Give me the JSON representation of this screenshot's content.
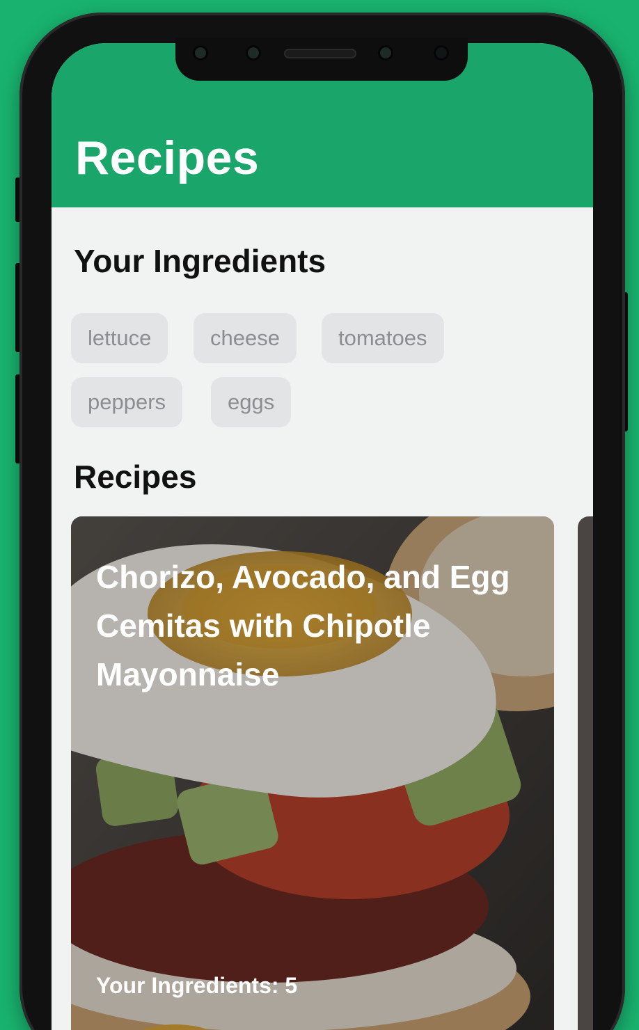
{
  "appbar": {
    "title": "Recipes"
  },
  "ingredients": {
    "heading": "Your Ingredients",
    "chips": [
      "lettuce",
      "cheese",
      "tomatoes",
      "peppers",
      "eggs"
    ]
  },
  "recipes": {
    "heading": "Recipes",
    "cards": [
      {
        "title": "Chorizo, Avocado, and Egg Cemitas with Chipotle Mayonnaise",
        "footer": "Your Ingredients: 5"
      }
    ]
  },
  "colors": {
    "brand": "#1aa56a",
    "background": "#19b36f",
    "chip": "#e2e4e5"
  }
}
